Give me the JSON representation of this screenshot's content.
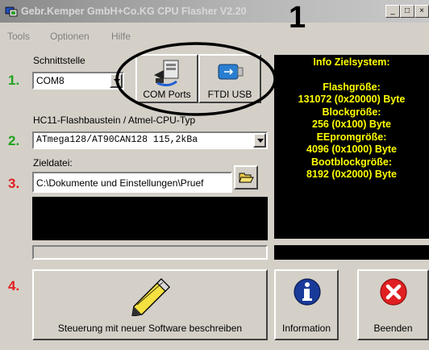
{
  "window": {
    "title": "Gebr.Kemper GmbH+Co.KG CPU Flasher V2.20",
    "controls": [
      "_",
      "□",
      "×"
    ]
  },
  "menu": [
    "Tools",
    "Optionen",
    "Hilfe"
  ],
  "annotation_top": "1",
  "steps": [
    "1.",
    "2.",
    "3.",
    "4."
  ],
  "port": {
    "label": "Schnittstelle",
    "value": "COM8"
  },
  "buttons": {
    "com_ports": "COM Ports",
    "ftdi_usb": "FTDI USB",
    "program": "Steuerung mit neuer Software beschreiben",
    "information": "Information",
    "exit": "Beenden"
  },
  "chip": {
    "label": "HC11-Flashbaustein / Atmel-CPU-Typ",
    "value": "ATmega128/AT90CAN128 115,2kBa"
  },
  "target": {
    "label": "Zieldatei:",
    "value": "C:\\Dokumente und Einstellungen\\Pruef"
  },
  "info_panel": {
    "lines": [
      "Info Zielsystem:",
      "",
      "Flashgröße:",
      "131072 (0x20000) Byte",
      "Blockgröße:",
      "256 (0x100) Byte",
      "EEpromgröße:",
      "4096 (0x1000) Byte",
      "Bootblockgröße:",
      "8192 (0x2000) Byte"
    ]
  },
  "colors": {
    "step_1": "#1ea21e",
    "step_2": "#1ea21e",
    "step_3": "#e02020",
    "step_4": "#e02020",
    "info_text": "#ffff00",
    "info_bg": "#000000"
  },
  "icons": [
    "app-icon",
    "computer-port-icon",
    "usb-stick-icon",
    "folder-open-icon",
    "pencil-icon",
    "info-icon",
    "close-x-icon"
  ]
}
